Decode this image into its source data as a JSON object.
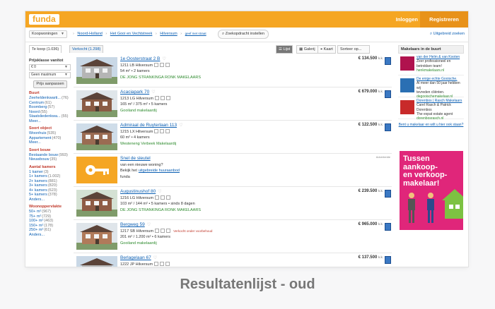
{
  "topbar": {
    "logo": "funda",
    "login": "Inloggen",
    "register": "Registreren"
  },
  "crumbbar": {
    "select_value": "Koopwoningen",
    "crumbs": [
      "Noord-Holland",
      "Het Gooi en Vechtstreek",
      "Hilversum",
      "geef met straat"
    ],
    "save_search": "Zoekopdracht instellen",
    "extended": "Uitgebreid zoeken"
  },
  "tabs": {
    "te_koop": "Te koop (1.036)",
    "verkocht": "Verkocht (1.298)"
  },
  "view": {
    "list": "Lijst",
    "gallery": "Galerij",
    "map": "Kaart",
    "sort": "Sorteer op..."
  },
  "filters": {
    "price_label": "Prijsklasse van/tot",
    "price_from": "€ 0",
    "price_to": "Geen maximum",
    "apply": "Prijs aanpassen",
    "groups": [
      {
        "title": "Buurt",
        "items": [
          [
            "Zeeheldenkwarti...",
            "(76)"
          ],
          [
            "Centrum",
            "(61)"
          ],
          [
            "Boomberg",
            "(57)"
          ],
          [
            "Noord",
            "(55)"
          ],
          [
            "Staatsliedenkwa...",
            "(55)"
          ],
          [
            "Meer...",
            ""
          ]
        ]
      },
      {
        "title": "Soort object",
        "items": [
          [
            "Woonhuis",
            "(535)"
          ],
          [
            "Appartement",
            "(470)"
          ],
          [
            "Meer...",
            ""
          ]
        ]
      },
      {
        "title": "Soort bouw",
        "items": [
          [
            "Bestaande bouw",
            "(993)"
          ],
          [
            "Nieuwbouw",
            "(35)"
          ]
        ]
      },
      {
        "title": "Aantal kamers",
        "items": [
          [
            "1 kamer",
            "(3)"
          ],
          [
            "1+ kamers",
            "(1.002)"
          ],
          [
            "2+ kamers",
            "(881)"
          ],
          [
            "3+ kamers",
            "(820)"
          ],
          [
            "4+ kamers",
            "(623)"
          ],
          [
            "5+ kamers",
            "(378)"
          ],
          [
            "Anders...",
            ""
          ]
        ]
      },
      {
        "title": "Woonoppervlakte",
        "items": [
          [
            "50+ m²",
            "(967)"
          ],
          [
            "75+ m²",
            "(729)"
          ],
          [
            "100+ m²",
            "(463)"
          ],
          [
            "150+ m²",
            "(178)"
          ],
          [
            "250+ m²",
            "(61)"
          ],
          [
            "Anders...",
            ""
          ]
        ]
      }
    ]
  },
  "listings": [
    {
      "addr": "1e Oosterstraat 2 B",
      "city": "1211 LB Hilversum",
      "size": "54 m² • 2 kamers",
      "agent": "DE JONG STRANKINGA RONK MAKELAARS",
      "price": "€ 134.500",
      "kk": "k.k.",
      "photo": "house-photo-icon"
    },
    {
      "addr": "Acaciapark 70",
      "city": "1213 LG Hilversum",
      "size": "165 m² / 375 m² • 5 kamers",
      "agent": "Gooiland makelaardij",
      "price": "€ 679.000",
      "kk": "k.k.",
      "photo": "house-photo-icon"
    },
    {
      "addr": "Admiraal de Ruyterlaan 113",
      "city": "1215 LX Hilversum",
      "size": "60 m² • 4 kamers",
      "agent": "Westeneng Verbeek Makelaardij",
      "price": "€ 122.500",
      "kk": "k.k.",
      "photo": "house-photo-icon"
    },
    {
      "addr": "Snel de sleutel",
      "city": "van een nieuwe woning?",
      "size": "Bekijk het",
      "size_link": "uitgebreide huuraanbod",
      "agent": "funda",
      "ad": "Advertentie",
      "photo": "key-icon"
    },
    {
      "addr": "Augustinushof 80",
      "city": "1216 LG Hilversum",
      "size": "103 m² / 144 m² • 5 kamers • sinds 8 dagen",
      "agent": "DE JONG STRANKINGA RONK MAKELAARS",
      "price": "€ 239.500",
      "kk": "k.k.",
      "photo": "house-photo-icon"
    },
    {
      "addr": "Bergweg 59",
      "city": "1217 SB Hilversum",
      "note": "Verkocht onder voorbehoud",
      "size": "201 m² / 1.200 m² • 6 kamers",
      "agent": "Gooiland makelaardij",
      "price": "€ 965.000",
      "kk": "k.k.",
      "photo": "house-photo-icon"
    },
    {
      "addr": "Berlagelaan 67",
      "city": "1222 JP Hilversum",
      "size": "",
      "agent": "",
      "price": "€ 137.500",
      "kk": "k.k.",
      "photo": "house-photo-icon"
    }
  ],
  "right": {
    "head": "Makelaars in de buurt",
    "agents": [
      {
        "title": "van der Helm & van Kooten",
        "lines": [
          "Zeer professioneel en",
          "betrokken team!"
        ],
        "link": "henkmakelaars.nl"
      },
      {
        "title": "De enige echte Gooische.",
        "lines": [
          "Al meer dan 50 jaar hebben wij",
          "tevreden cliënten."
        ],
        "link": "degooischemakelaar.nl"
      },
      {
        "title": "Dorenbos | Rasch Makelaars",
        "lines": [
          "Carel Rasch & Patrick Dorenbos",
          "The expat estate agent"
        ],
        "link": "dorenbosrasch.nl"
      }
    ],
    "footer": "Bent u makelaar en wilt u hier ook staan?",
    "banner_lines": [
      "Tussen aankoop-",
      "en verkoop-",
      "makelaar!"
    ]
  },
  "caption": "Resultatenlijst - oud"
}
